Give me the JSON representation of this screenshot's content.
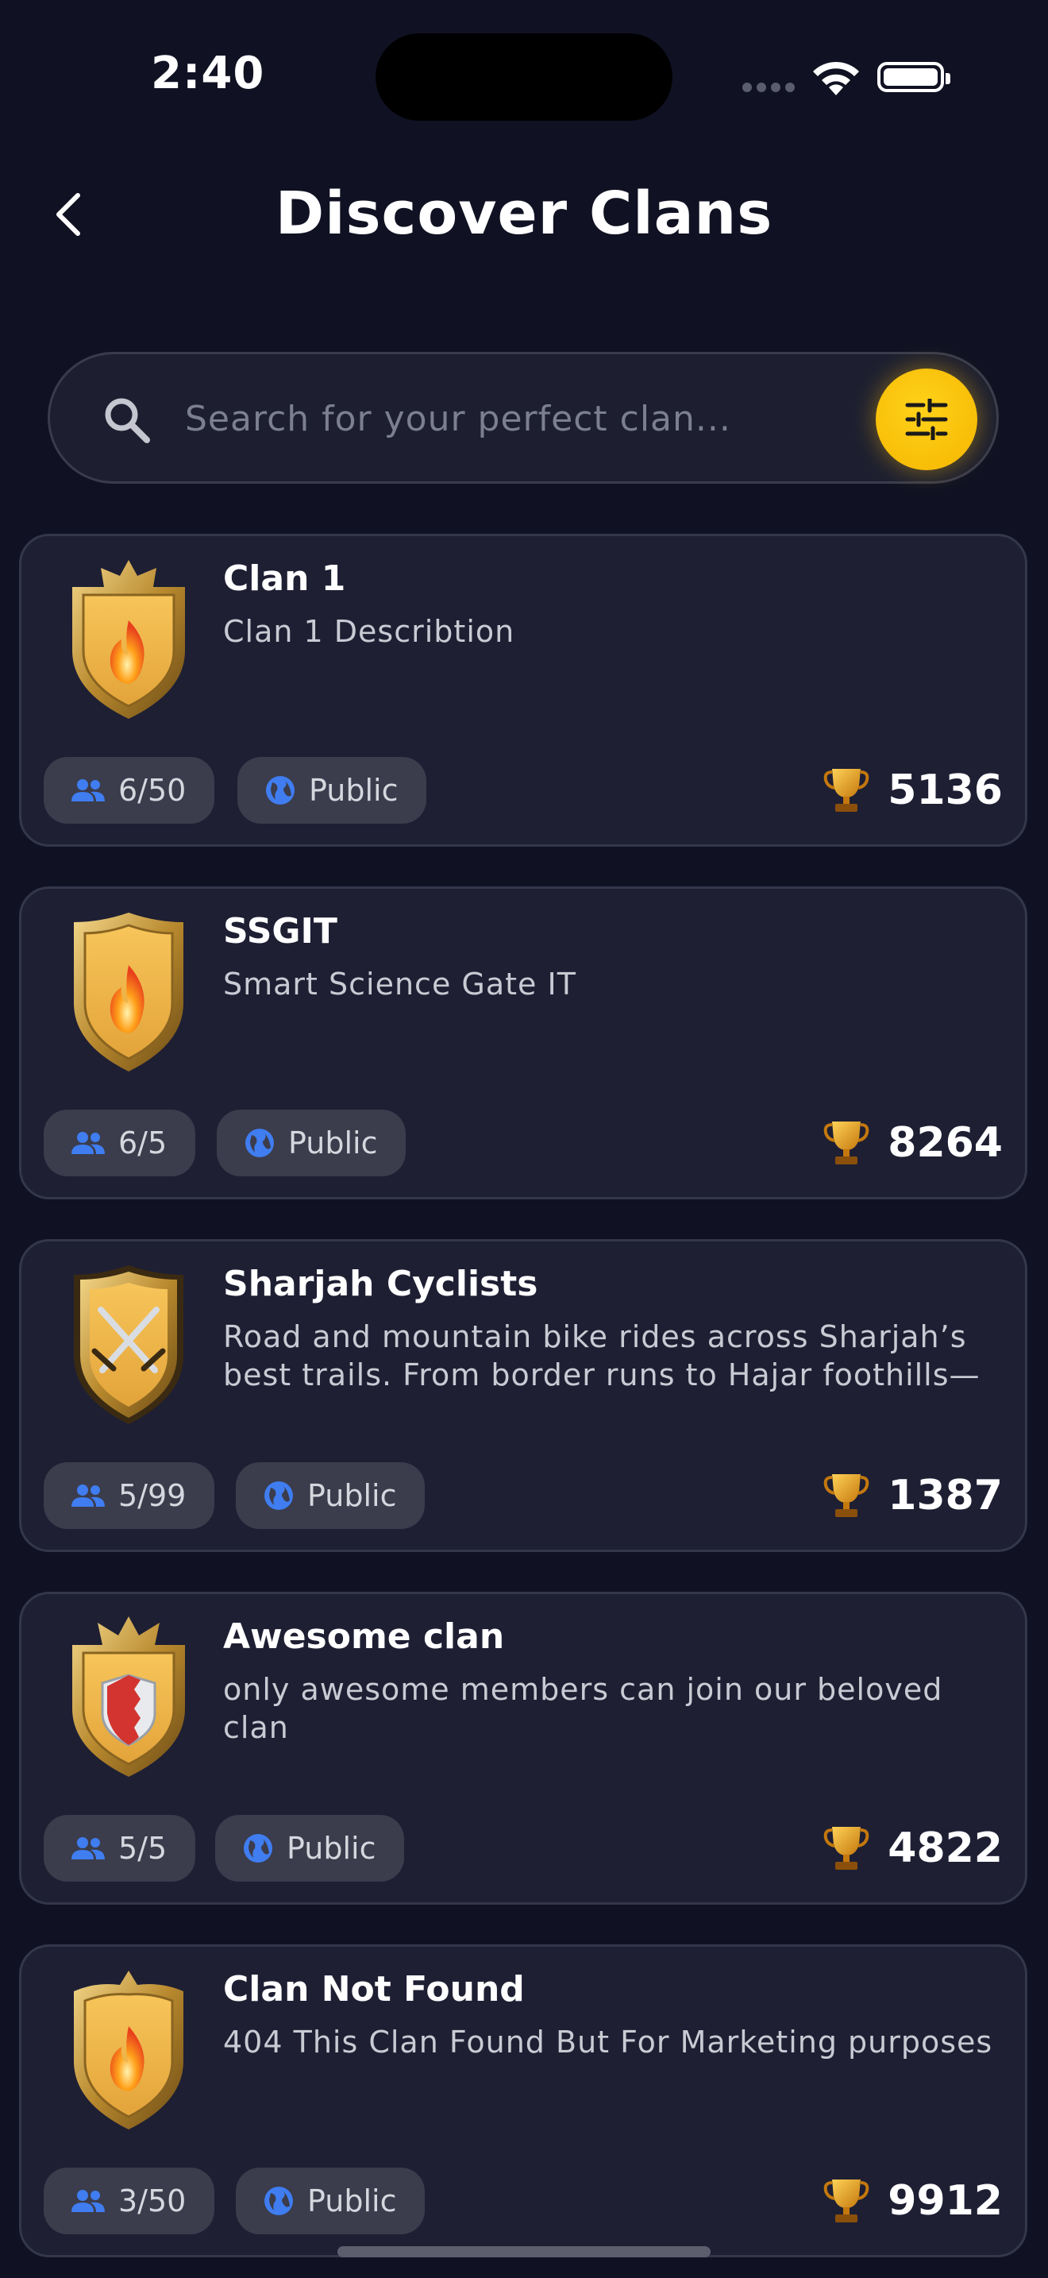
{
  "status_bar": {
    "time": "2:40"
  },
  "header": {
    "title": "Discover Clans"
  },
  "search": {
    "placeholder": "Search for your perfect clan..."
  },
  "colors": {
    "accent": "#FFC107",
    "background": "#101223",
    "card": "#1E1F33",
    "pill": "#3B3C4C",
    "icon_blue": "#3F7DF0"
  },
  "clans": [
    {
      "name": "Clan  1",
      "description": "Clan 1 Describtion",
      "members": "6/50",
      "visibility": "Public",
      "trophies": "5136",
      "emblem": "fire-shield-icon"
    },
    {
      "name": "SSGIT",
      "description": "Smart Science Gate IT",
      "members": "6/5",
      "visibility": "Public",
      "trophies": "8264",
      "emblem": "fire-shield-icon"
    },
    {
      "name": "Sharjah Cyclists",
      "description": "Road and mountain bike rides across Sharjah’s best trails. From border runs to Hajar foothills—j...",
      "members": "5/99",
      "visibility": "Public",
      "trophies": "1387",
      "emblem": "crossed-swords-shield-icon"
    },
    {
      "name": "Awesome clan",
      "description": "only awesome members can join our beloved clan",
      "members": "5/5",
      "visibility": "Public",
      "trophies": "4822",
      "emblem": "flag-shield-icon"
    },
    {
      "name": "Clan Not Found",
      "description": "404 This Clan Found But For Marketing purposes",
      "members": "3/50",
      "visibility": "Public",
      "trophies": "9912",
      "emblem": "fire-shield-icon"
    }
  ]
}
